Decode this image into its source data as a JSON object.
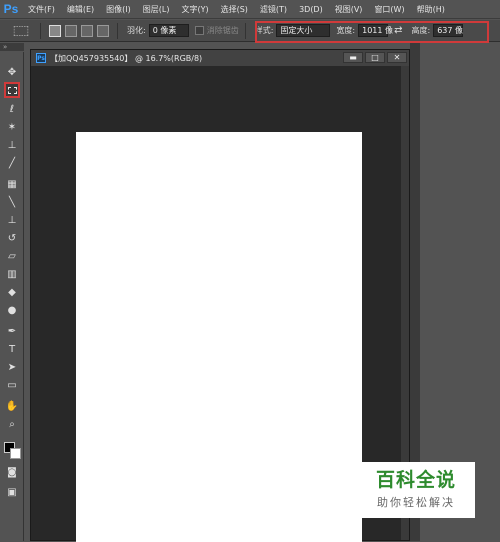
{
  "app": {
    "logo": "Ps"
  },
  "menubar": {
    "items": [
      "文件(F)",
      "编辑(E)",
      "图像(I)",
      "图层(L)",
      "文字(Y)",
      "选择(S)",
      "滤镜(T)",
      "3D(D)",
      "视图(V)",
      "窗口(W)",
      "帮助(H)"
    ]
  },
  "options": {
    "feather_label": "羽化:",
    "feather_value": "0 像素",
    "antialias_label": "消除锯齿",
    "style_label": "样式:",
    "style_value": "固定大小",
    "width_label": "宽度:",
    "width_value": "1011 像",
    "height_label": "高度:",
    "height_value": "637 像"
  },
  "document": {
    "title": "【加QQ457935540】 @ 16.7%(RGB/8)",
    "min_label": "▬",
    "max_label": "□",
    "close_label": "✕"
  },
  "toolbox": {
    "collapse_label": "»",
    "tools": [
      "move-tool",
      "rect-marquee-tool",
      "lasso-tool",
      "magic-wand-tool",
      "crop-tool",
      "eyedropper-tool",
      "healing-tool",
      "brush-tool",
      "clone-stamp-tool",
      "history-brush-tool",
      "eraser-tool",
      "gradient-tool",
      "blur-tool",
      "dodge-tool",
      "pen-tool",
      "type-tool",
      "path-select-tool",
      "shape-tool",
      "hand-tool",
      "zoom-tool"
    ],
    "type_glyph": "T"
  },
  "colors": {
    "accent_highlight": "#d03a3a",
    "foreground": "#000000",
    "background": "#ffffff"
  },
  "watermark": {
    "title": "百科全说",
    "subtitle": "助你轻松解决"
  }
}
